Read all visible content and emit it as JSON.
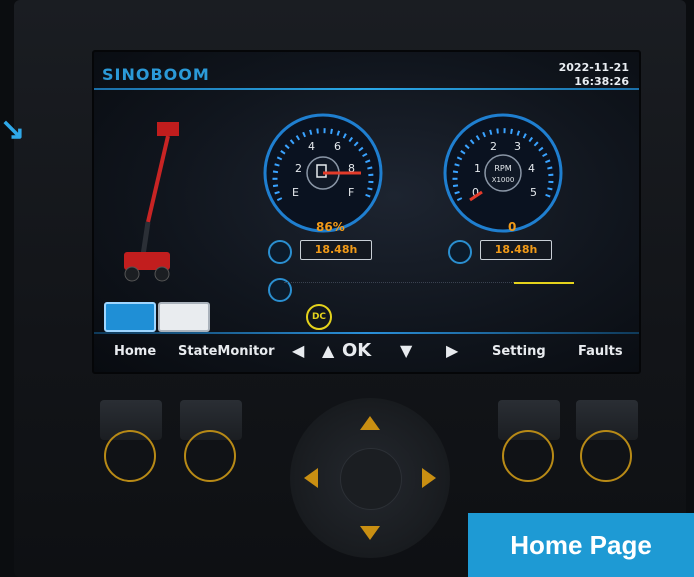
{
  "brand": "SINOBOOM",
  "datetime": {
    "date": "2022-11-21",
    "time": "16:38:26"
  },
  "fuel_gauge": {
    "ticks": [
      "2",
      "4",
      "6",
      "8"
    ],
    "empty_label": "E",
    "full_label": "F",
    "percent": "86%",
    "hours": "18.48h",
    "level": 0.86
  },
  "rpm_gauge": {
    "ticks": [
      "0",
      "1",
      "2",
      "3",
      "4",
      "5"
    ],
    "unit_label": "RPM",
    "multiplier_label": "X1000",
    "value": "0",
    "hours": "18.48h"
  },
  "dc_label": "DC",
  "softkeys": {
    "home": "Home",
    "state_monitor": "StateMonitor",
    "left": "◀",
    "up": "▲",
    "ok": "OK",
    "down": "▼",
    "right": "▶",
    "setting": "Setting",
    "faults": "Faults"
  },
  "caption": "Home Page",
  "colors": {
    "accent": "#2b9ad8",
    "readout": "#f19a18",
    "dc": "#e4d21c",
    "caption_bg": "#1e9ad4"
  }
}
